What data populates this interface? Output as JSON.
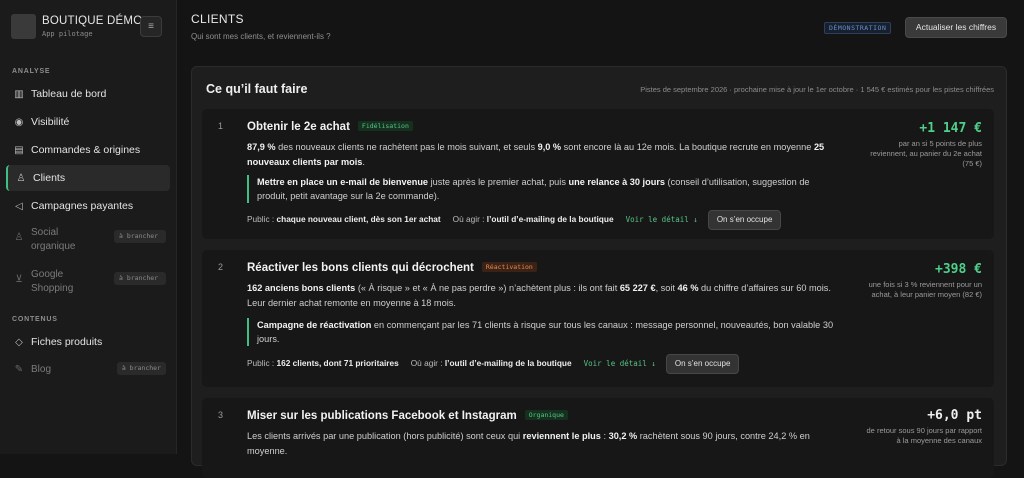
{
  "app": {
    "name": "BOUTIQUE DÉMO",
    "subtitle": "App pilotage",
    "menu_icon": "≡"
  },
  "sidebar": {
    "sections": [
      {
        "label": "ANALYSE"
      },
      {
        "label": "CONTENUS"
      }
    ],
    "items": [
      {
        "label": "Tableau de bord",
        "icon": "chart-icon",
        "glyph": "📊"
      },
      {
        "label": "Visibilité",
        "icon": "eye-icon",
        "glyph": "👁"
      },
      {
        "label": "Commandes & origines",
        "icon": "receipt-icon",
        "glyph": "▤"
      },
      {
        "label": "Clients",
        "icon": "user-icon",
        "glyph": "👤"
      },
      {
        "label": "Campagnes payantes",
        "icon": "megaphone-icon",
        "glyph": "📢"
      },
      {
        "label": "Social organique",
        "icon": "people-icon",
        "glyph": "👥",
        "badge": "à brancher"
      },
      {
        "label": "Google Shopping",
        "icon": "cart-icon",
        "glyph": "🛒",
        "badge": "à brancher"
      },
      {
        "label": "Fiches produits",
        "icon": "tag-icon",
        "glyph": "🏷"
      },
      {
        "label": "Blog",
        "icon": "pen-icon",
        "glyph": "✎",
        "badge": "à brancher"
      }
    ]
  },
  "header": {
    "title": "CLIENTS",
    "subtitle": "Qui sont mes clients, et reviennent-ils ?",
    "badge": "DÉMONSTRATION",
    "refresh_label": "Actualiser les chiffres"
  },
  "panel": {
    "title": "Ce qu’il faut faire",
    "meta": "Pistes de septembre 2026 · prochaine mise à jour le 1er octobre · 1 545 € estimés pour les pistes chiffrées"
  },
  "cards": [
    {
      "num": "1",
      "title": "Obtenir le 2e achat",
      "tag": "Fidélisation",
      "desc": [
        "87,9 %",
        " des nouveaux clients ne rachètent pas le mois suivant, et seuls ",
        "9,0 %",
        " sont encore là au 12e mois. La boutique recrute en moyenne ",
        "25 nouveaux clients par mois",
        "."
      ],
      "action": [
        "Mettre en place un e-mail de bienvenue",
        " juste après le premier achat, puis ",
        "une relance à 30 jours",
        " (conseil d’utilisation, suggestion de produit, petit avantage sur la 2e commande)."
      ],
      "public_label": "Public : ",
      "public": "chaque nouveau client, dès son 1er achat",
      "where_label": "Où agir : ",
      "where": "l’outil d’e-mailing de la boutique",
      "detail": "Voir le détail ↓",
      "occupy": "On s’en occupe",
      "gain": "+1 147 €",
      "gain_note": "par an si 5 points de plus reviennent, au panier du 2e achat (75 €)"
    },
    {
      "num": "2",
      "title": "Réactiver les bons clients qui décrochent",
      "tag": "Réactivation",
      "desc": [
        "162 anciens bons clients",
        " (« À risque » et « À ne pas perdre ») n’achètent plus : ils ont fait ",
        "65 227 €",
        ", soit ",
        "46 %",
        " du chiffre d’affaires sur 60 mois. Leur dernier achat remonte en moyenne à 18 mois."
      ],
      "action": [
        "Campagne de réactivation",
        " en commençant par les 71 clients à risque sur tous les canaux : message personnel, nouveautés, bon valable 30 jours.",
        "",
        ""
      ],
      "public_label": "Public : ",
      "public": "162 clients, dont 71 prioritaires",
      "where_label": "Où agir : ",
      "where": "l’outil d’e-mailing de la boutique",
      "detail": "Voir le détail ↓",
      "occupy": "On s’en occupe",
      "gain": "+398 €",
      "gain_note": "une fois si 3 % reviennent pour un achat, à leur panier moyen (82 €)"
    },
    {
      "num": "3",
      "title": "Miser sur les publications Facebook et Instagram",
      "tag": "Organique",
      "desc": [
        "Les clients arrivés par une publication (hors publicité) sont ceux qui ",
        "reviennent le plus",
        " : ",
        "30,2 %",
        " rachètent sous 90 jours, contre 24,2 % en moyenne.",
        "",
        ""
      ],
      "gain": "+6,0 pt",
      "gain_note": "de retour sous 90 jours par rapport à la moyenne des canaux"
    }
  ]
}
